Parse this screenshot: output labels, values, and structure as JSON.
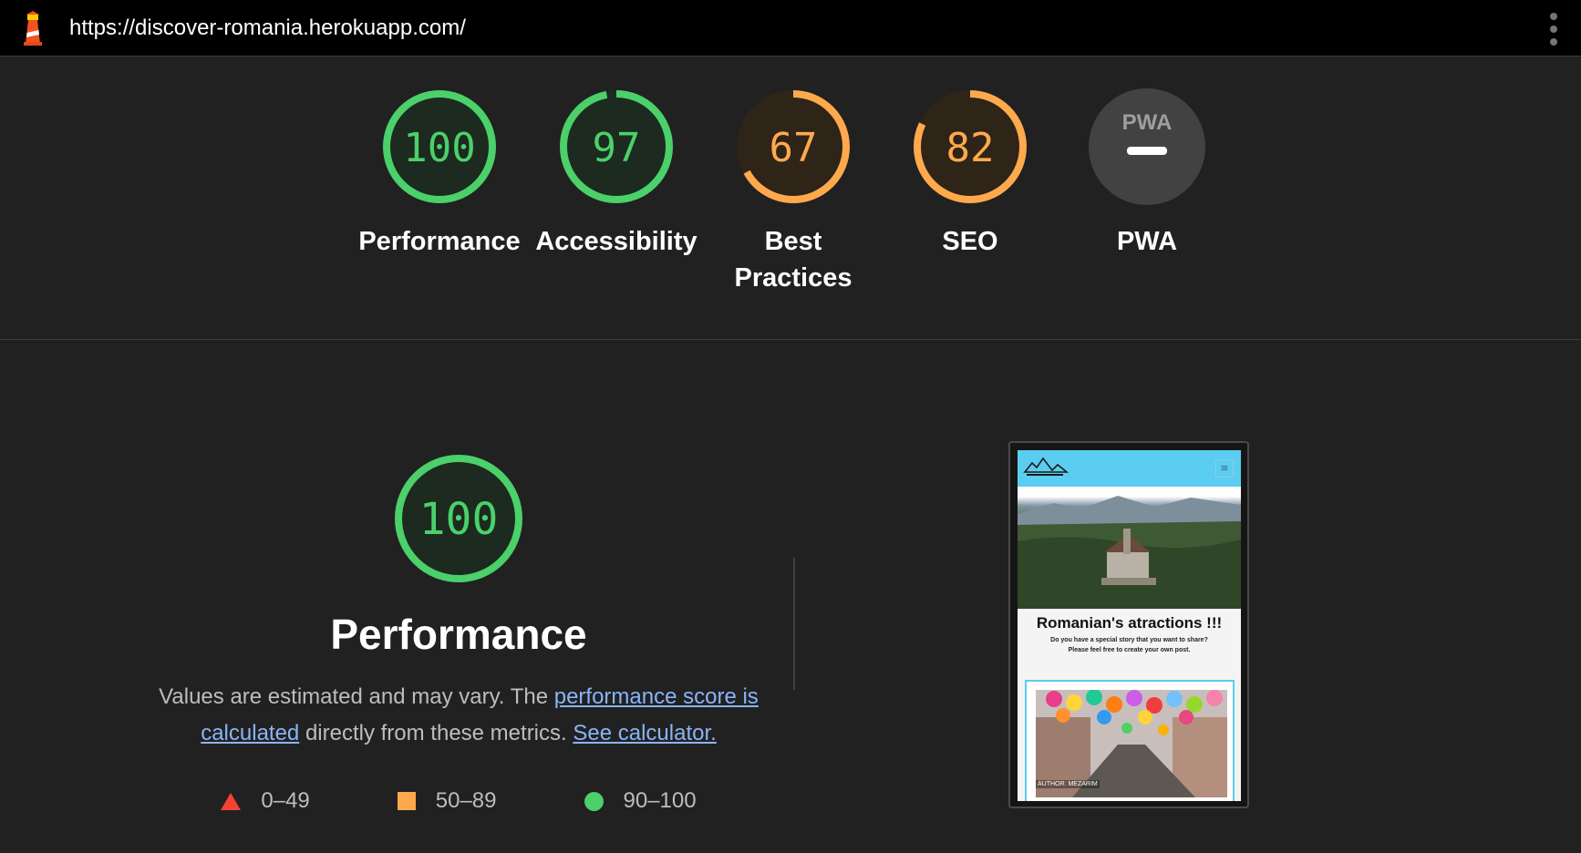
{
  "browser": {
    "url": "https://discover-romania.herokuapp.com/"
  },
  "colors": {
    "pass": "#4bd06a",
    "average": "#ffa94d",
    "fail": "#f44336",
    "link": "#8ab4f8",
    "background": "#212121"
  },
  "gauges": [
    {
      "label": "Performance",
      "score": "100",
      "value": 100,
      "status": "pass"
    },
    {
      "label": "Accessibility",
      "score": "97",
      "value": 97,
      "status": "pass"
    },
    {
      "label": "Best Practices",
      "score": "67",
      "value": 67,
      "status": "average"
    },
    {
      "label": "SEO",
      "score": "82",
      "value": 82,
      "status": "average"
    },
    {
      "label": "PWA",
      "score": "",
      "badge": "PWA",
      "status": "na"
    }
  ],
  "performance": {
    "score": "100",
    "value": 100,
    "title": "Performance",
    "desc_prefix": "Values are estimated and may vary. The ",
    "desc_link1": "performance score is calculated",
    "desc_middle": " directly from these metrics. ",
    "desc_link2": "See calculator.",
    "legend": [
      {
        "range": "0–49",
        "icon": "triangle-icon"
      },
      {
        "range": "50–89",
        "icon": "square-icon"
      },
      {
        "range": "90–100",
        "icon": "circle-icon"
      }
    ]
  },
  "screenshot": {
    "heading": "Romanian's atractions !!!",
    "subtext_line1": "Do you have a special story that you want to share?",
    "subtext_line2": "Please feel free to create your own post.",
    "author": "AUTHOR: MEZARIM",
    "menu_glyph": "≡"
  }
}
